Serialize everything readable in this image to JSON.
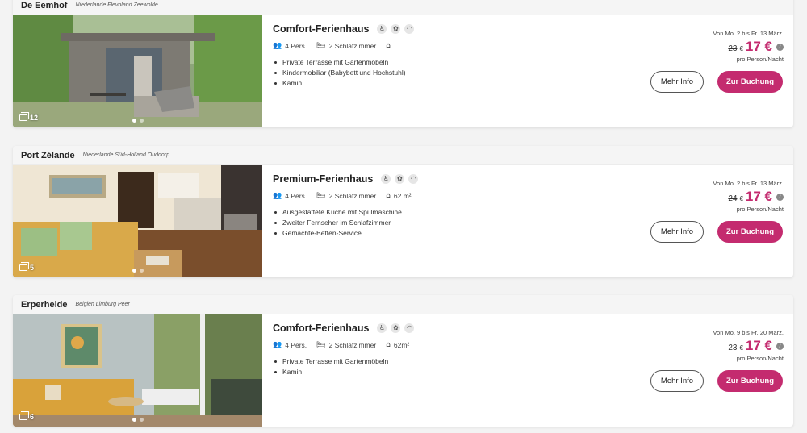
{
  "colors": {
    "accent": "#c42b6f",
    "page_bg": "#f3f3f3",
    "card_head_bg": "#f5f5f5"
  },
  "listings": [
    {
      "park": "De Eemhof",
      "location": "Niederlande  Flevoland  Zeewolde",
      "photo_count": "12",
      "title": "Comfort-Ferienhaus",
      "amenities": [
        "wheelchair-icon",
        "pets-icon",
        "wifi-icon"
      ],
      "persons": "4 Pers.",
      "bedrooms": "2 Schlafzimmer",
      "area": "",
      "features": [
        "Private Terrasse mit Gartenmöbeln",
        "Kindermobiliar (Babybett und Hochstuhl)",
        "Kamin"
      ],
      "period": "Von Mo. 2 bis Fr. 13 März.",
      "old_price": "23",
      "currency": "€",
      "new_price": "17 €",
      "price_unit": "pro Person/Nacht",
      "info_label": "Mehr Info",
      "book_label": "Zur Buchung"
    },
    {
      "park": "Port Zélande",
      "location": "Niederlande  Süd-Holland  Ouddorp",
      "photo_count": "5",
      "title": "Premium-Ferienhaus",
      "amenities": [
        "wheelchair-icon",
        "pets-icon",
        "wifi-icon"
      ],
      "persons": "4 Pers.",
      "bedrooms": "2 Schlafzimmer",
      "area": "62 m²",
      "features": [
        "Ausgestattete Küche mit Spülmaschine",
        "Zweiter Fernseher im Schlafzimmer",
        "Gemachte-Betten-Service"
      ],
      "period": "Von Mo. 2 bis Fr. 13 März.",
      "old_price": "24",
      "currency": "€",
      "new_price": "17 €",
      "price_unit": "pro Person/Nacht",
      "info_label": "Mehr Info",
      "book_label": "Zur Buchung"
    },
    {
      "park": "Erperheide",
      "location": "Belgien  Limburg  Peer",
      "photo_count": "6",
      "title": "Comfort-Ferienhaus",
      "amenities": [
        "wheelchair-icon",
        "pets-icon",
        "wifi-icon"
      ],
      "persons": "4 Pers.",
      "bedrooms": "2 Schlafzimmer",
      "area": "62m²",
      "features": [
        "Private Terrasse mit Gartenmöbeln",
        "Kamin"
      ],
      "period": "Von Mo. 9 bis Fr. 20 März.",
      "old_price": "23",
      "currency": "€",
      "new_price": "17 €",
      "price_unit": "pro Person/Nacht",
      "info_label": "Mehr Info",
      "book_label": "Zur Buchung"
    }
  ]
}
